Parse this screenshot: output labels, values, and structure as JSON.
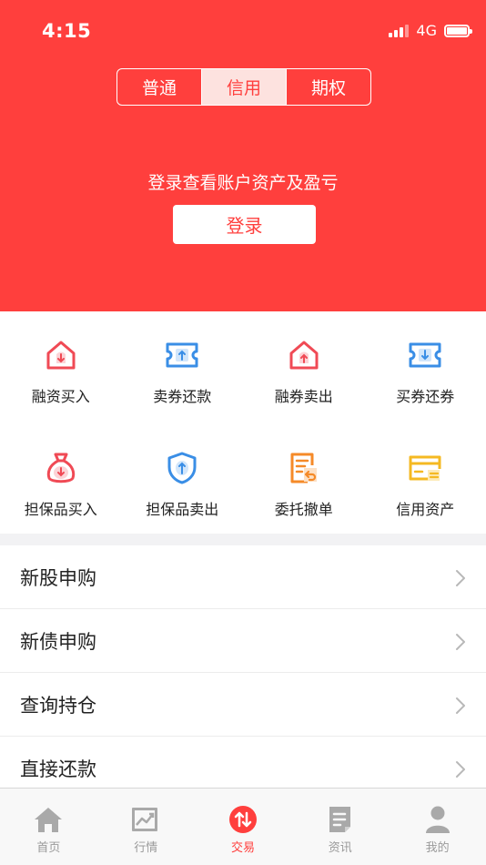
{
  "status_bar": {
    "time": "4:15",
    "network": "4G"
  },
  "header": {
    "segments": [
      "普通",
      "信用",
      "期权"
    ],
    "active_segment": "信用",
    "login_prompt": "登录查看账户资产及盈亏",
    "login_button": "登录"
  },
  "grid": [
    {
      "label": "融资买入",
      "icon": "house-down-icon",
      "color": "#f04a55"
    },
    {
      "label": "卖券还款",
      "icon": "ticket-up-icon",
      "color": "#3a8ee6"
    },
    {
      "label": "融券卖出",
      "icon": "house-up-icon",
      "color": "#f04a55"
    },
    {
      "label": "买券还券",
      "icon": "ticket-down-icon",
      "color": "#3a8ee6"
    },
    {
      "label": "担保品买入",
      "icon": "money-bag-icon",
      "color": "#f04a55"
    },
    {
      "label": "担保品卖出",
      "icon": "shield-up-icon",
      "color": "#3a8ee6"
    },
    {
      "label": "委托撤单",
      "icon": "document-return-icon",
      "color": "#f58a28"
    },
    {
      "label": "信用资产",
      "icon": "card-icon",
      "color": "#f5b922"
    }
  ],
  "list": [
    {
      "label": "新股申购"
    },
    {
      "label": "新债申购"
    },
    {
      "label": "查询持仓"
    },
    {
      "label": "直接还款"
    }
  ],
  "tabbar": [
    {
      "label": "首页",
      "icon": "home-icon"
    },
    {
      "label": "行情",
      "icon": "chart-icon"
    },
    {
      "label": "交易",
      "icon": "trade-icon"
    },
    {
      "label": "资讯",
      "icon": "news-icon"
    },
    {
      "label": "我的",
      "icon": "profile-icon"
    }
  ],
  "active_tab": "交易",
  "colors": {
    "brand_red": "#ff3f3d",
    "blue": "#3a8ee6",
    "orange": "#f58a28",
    "yellow": "#f5b922",
    "inactive_gray": "#9a9a9a"
  }
}
